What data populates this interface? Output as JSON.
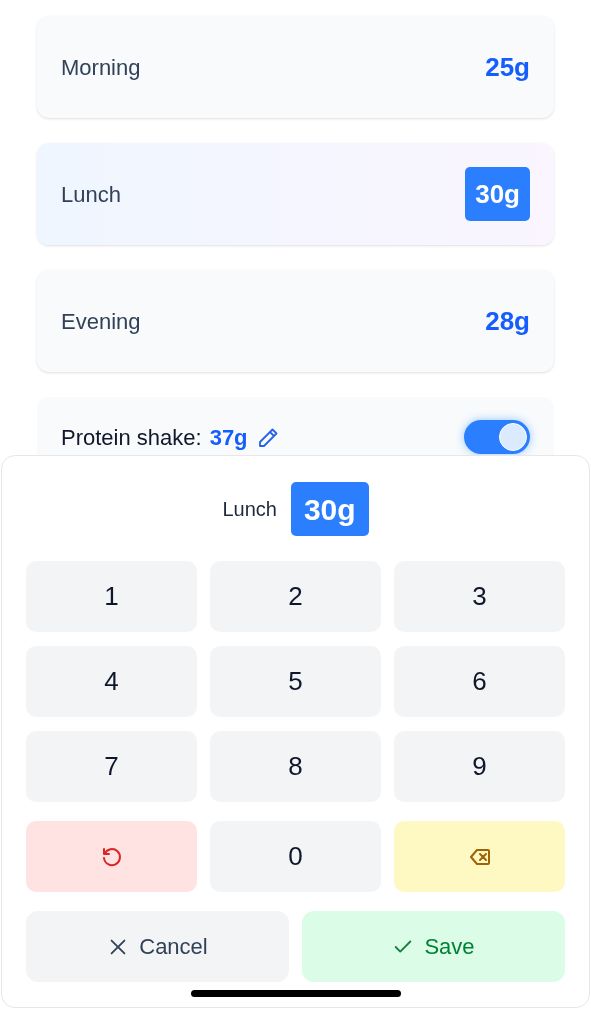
{
  "meals": [
    {
      "label": "Morning",
      "amount": "25g",
      "selected": false
    },
    {
      "label": "Lunch",
      "amount": "30g",
      "selected": true
    },
    {
      "label": "Evening",
      "amount": "28g",
      "selected": false
    }
  ],
  "shake": {
    "label": "Protein shake:",
    "amount": "37g",
    "on": true
  },
  "editor": {
    "meal": "Lunch",
    "amount": "30g"
  },
  "keys": [
    {
      "kind": "digit",
      "label": "1"
    },
    {
      "kind": "digit",
      "label": "2"
    },
    {
      "kind": "digit",
      "label": "3"
    },
    {
      "kind": "digit",
      "label": "4"
    },
    {
      "kind": "digit",
      "label": "5"
    },
    {
      "kind": "digit",
      "label": "6"
    },
    {
      "kind": "digit",
      "label": "7"
    },
    {
      "kind": "digit",
      "label": "8"
    },
    {
      "kind": "digit",
      "label": "9"
    },
    {
      "kind": "reset"
    },
    {
      "kind": "digit",
      "label": "0"
    },
    {
      "kind": "backspace"
    }
  ],
  "actions": {
    "cancel": "Cancel",
    "save": "Save"
  }
}
